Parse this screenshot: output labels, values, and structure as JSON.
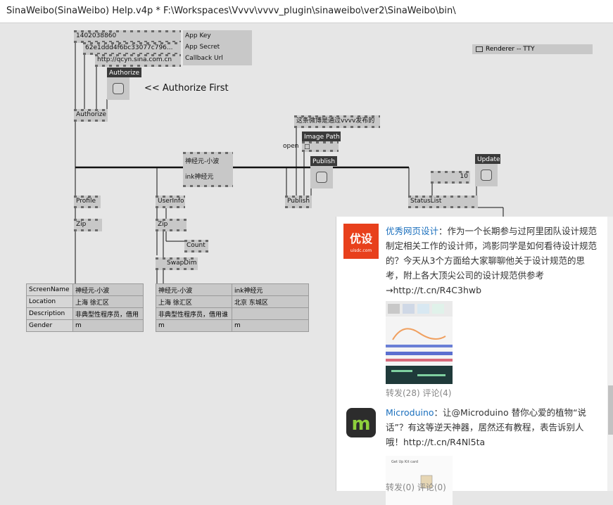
{
  "window": {
    "title": "SinaWeibo(SinaWeibo) Help.v4p *  F:\\Workspaces\\Vvvv\\vvvv_plugin\\sinaweibo\\ver2\\SinaWeibo\\bin\\"
  },
  "inputs": {
    "app_key_value": "1402038860",
    "app_secret_value": "62e1ddd4f6bc33077c796...",
    "callback_value": "http://qcyn.sina.com.cn"
  },
  "labels": {
    "app_key": "App Key",
    "app_secret": "App Secret",
    "callback_url": "Callback Url",
    "authorize_tag": "Authorize",
    "authorize_hint": "<< Authorize First",
    "renderer": "Renderer -- TTY"
  },
  "nodes": {
    "authorize": "Authorize",
    "profile": "Profile",
    "zip1": "Zip",
    "userinfo": "UserInfo",
    "zip2": "Zip",
    "count": "Count",
    "swapdim": "SwapDim",
    "publish_node": "Publish",
    "statuslist": "StatusList",
    "open": "open"
  },
  "publish": {
    "message": "这条微博是通过vvvv发布的",
    "image_path_tag": "Image Path",
    "image_path_value": "□",
    "publish_tag": "Publish",
    "update_tag": "Update",
    "count_value": "10"
  },
  "names_box": {
    "line1": "神经元-小波",
    "line2": "ink神经元"
  },
  "profile_table": {
    "rows": [
      {
        "key": "ScreenName",
        "value": "神经元-小波"
      },
      {
        "key": "Location",
        "value": "上海 徐汇区"
      },
      {
        "key": "Description",
        "value": "非典型性程序员，借用"
      },
      {
        "key": "Gender",
        "value": "m"
      }
    ]
  },
  "userinfo_table": {
    "rows": [
      [
        "神经元-小波",
        "ink神经元"
      ],
      [
        "上海 徐汇区",
        "北京 东城区"
      ],
      [
        "非典型性程序员，借用谁",
        ""
      ],
      [
        "m",
        "m"
      ]
    ]
  },
  "feed": {
    "posts": [
      {
        "avatar_text": "优设",
        "avatar_sub": "uisdc.com",
        "avatar_color": "#e8401c",
        "nickname": "优秀网页设计",
        "text": "：作为一个长期参与过阿里团队设计规范制定相关工作的设计师，鸿影同学是如何看待设计规范的？今天从3个方面给大家聊聊他关于设计规范的思考，附上各大顶尖公司的设计规范供参考→http://t.cn/R4C3hwb",
        "meta": "转发(28) 评论(4)"
      },
      {
        "avatar_text": "m",
        "avatar_color": "#2c2c2c",
        "nickname": "Microduino",
        "text": "：让@Microduino 替你心爱的植物“说话”？有这等逆天神器，居然还有教程，表告诉别人哦！http://t.cn/R4Nl5ta",
        "image_caption": "Get Up Kit card",
        "meta": "转发(0) 评论(0)"
      }
    ]
  }
}
